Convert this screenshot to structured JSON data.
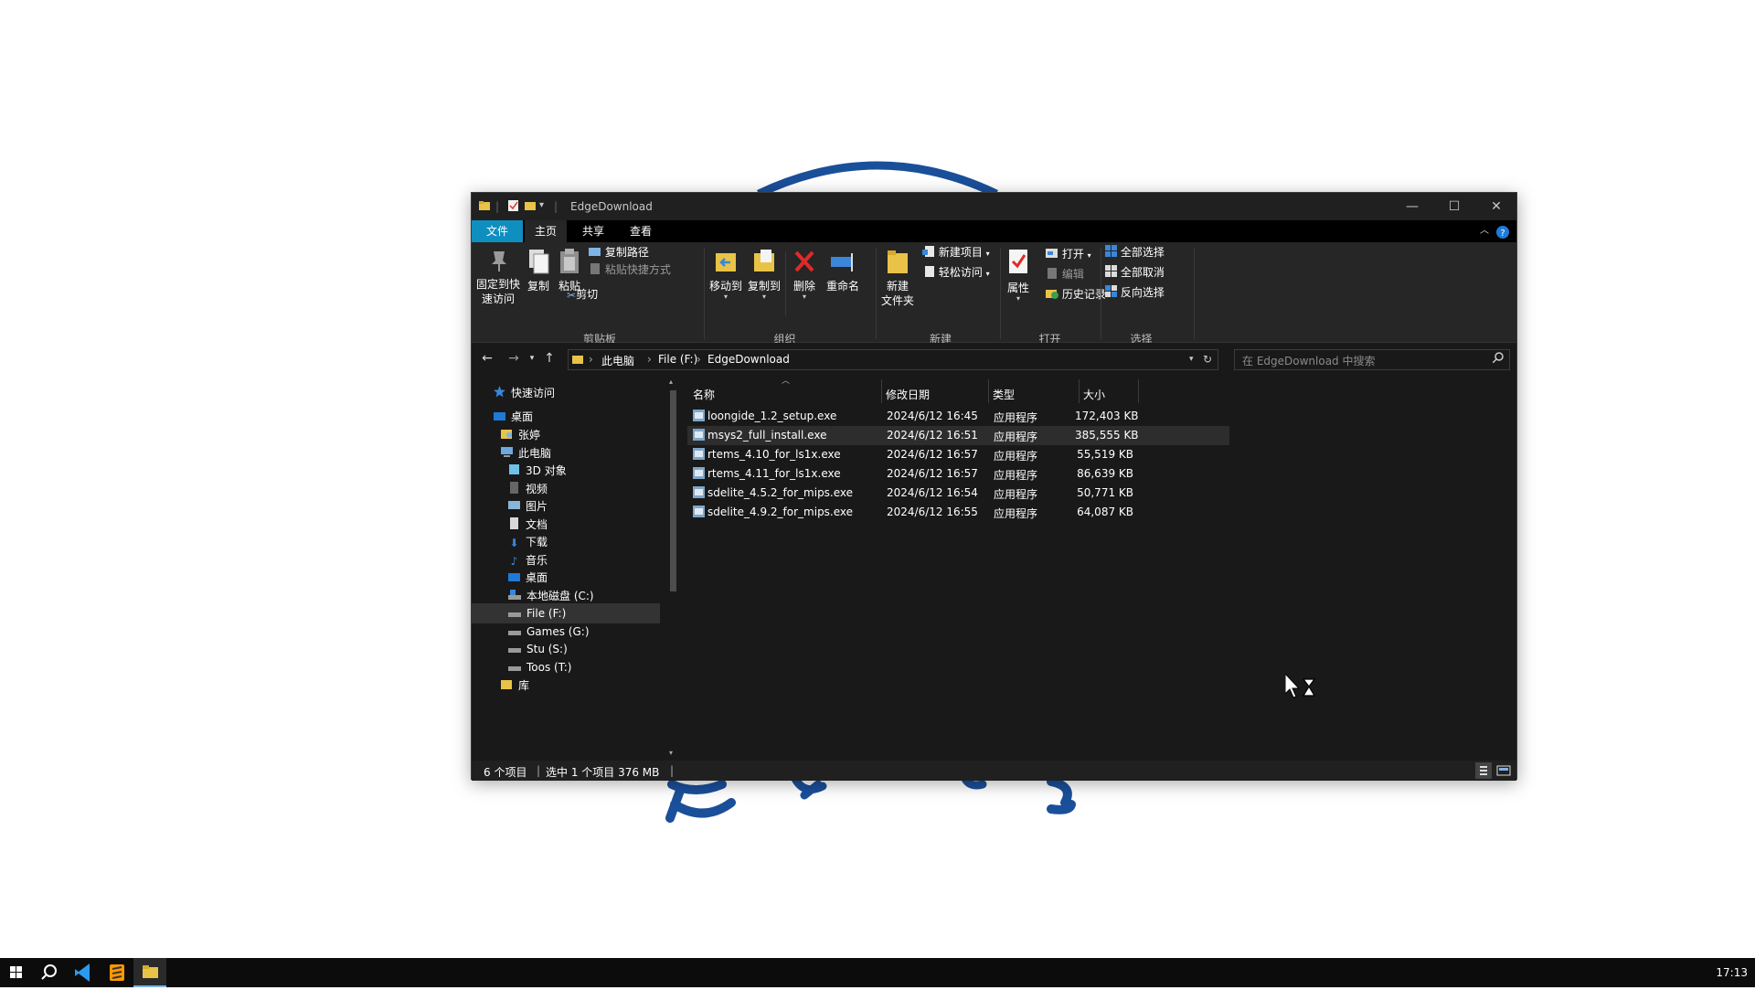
{
  "window": {
    "title": "EdgeDownload",
    "controls": {
      "minimize": "—",
      "maximize": "☐",
      "close": "✕"
    }
  },
  "ribbon_tabs": [
    "文件",
    "主页",
    "共享",
    "查看"
  ],
  "ribbon": {
    "pin": "固定到快速访问",
    "copy": "复制",
    "paste": "粘贴",
    "copy_path": "复制路径",
    "paste_shortcut": "粘贴快捷方式",
    "cut": "剪切",
    "group_clipboard": "剪贴板",
    "move_to": "移动到",
    "copy_to": "复制到",
    "delete": "删除",
    "rename": "重命名",
    "group_organize": "组织",
    "new_folder_1": "新建",
    "new_folder_2": "文件夹",
    "new_item": "新建项目",
    "easy_access": "轻松访问",
    "group_new": "新建",
    "properties": "属性",
    "open": "打开",
    "edit": "编辑",
    "history": "历史记录",
    "group_open": "打开",
    "select_all": "全部选择",
    "select_none": "全部取消",
    "invert_selection": "反向选择",
    "group_select": "选择"
  },
  "address": {
    "crumbs": [
      "此电脑",
      "File (F:)",
      "EdgeDownload"
    ],
    "search_placeholder": "在 EdgeDownload 中搜索"
  },
  "nav": [
    {
      "label": "快速访问",
      "icon": "star-icon"
    },
    {
      "label": "桌面",
      "icon": "desktop-icon"
    },
    {
      "label": "张婷",
      "icon": "user-folder-icon"
    },
    {
      "label": "此电脑",
      "icon": "pc-icon"
    },
    {
      "label": "3D 对象",
      "icon": "cube-icon"
    },
    {
      "label": "视频",
      "icon": "video-icon"
    },
    {
      "label": "图片",
      "icon": "picture-icon"
    },
    {
      "label": "文档",
      "icon": "document-icon"
    },
    {
      "label": "下载",
      "icon": "download-icon"
    },
    {
      "label": "音乐",
      "icon": "music-icon"
    },
    {
      "label": "桌面",
      "icon": "desktop-icon"
    },
    {
      "label": "本地磁盘 (C:)",
      "icon": "system-drive-icon"
    },
    {
      "label": "File (F:)",
      "icon": "drive-icon"
    },
    {
      "label": "Games (G:)",
      "icon": "drive-icon"
    },
    {
      "label": "Stu (S:)",
      "icon": "drive-icon"
    },
    {
      "label": "Toos (T:)",
      "icon": "drive-icon"
    },
    {
      "label": "库",
      "icon": "library-icon"
    }
  ],
  "columns": {
    "name": "名称",
    "date": "修改日期",
    "type": "类型",
    "size": "大小"
  },
  "files": [
    {
      "name": "loongide_1.2_setup.exe",
      "date": "2024/6/12 16:45",
      "type": "应用程序",
      "size": "172,403 KB"
    },
    {
      "name": "msys2_full_install.exe",
      "date": "2024/6/12 16:51",
      "type": "应用程序",
      "size": "385,555 KB"
    },
    {
      "name": "rtems_4.10_for_ls1x.exe",
      "date": "2024/6/12 16:57",
      "type": "应用程序",
      "size": "55,519 KB"
    },
    {
      "name": "rtems_4.11_for_ls1x.exe",
      "date": "2024/6/12 16:57",
      "type": "应用程序",
      "size": "86,639 KB"
    },
    {
      "name": "sdelite_4.5.2_for_mips.exe",
      "date": "2024/6/12 16:54",
      "type": "应用程序",
      "size": "50,771 KB"
    },
    {
      "name": "sdelite_4.9.2_for_mips.exe",
      "date": "2024/6/12 16:55",
      "type": "应用程序",
      "size": "64,087 KB"
    }
  ],
  "status": {
    "count": "6 个项目",
    "selection": "选中 1 个项目  376 MB"
  },
  "taskbar": {
    "clock": "17:13"
  },
  "colors": {
    "accent": "#0f8fbf",
    "selection": "#2d2d2d",
    "wallpaper_logo": "#1a4f9a"
  }
}
